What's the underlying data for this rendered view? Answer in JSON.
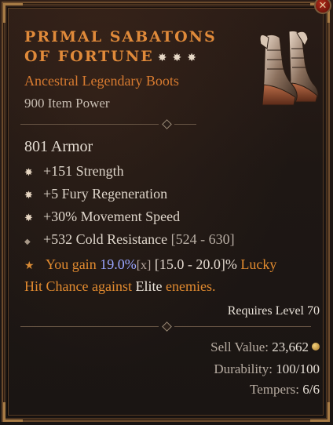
{
  "item": {
    "name": "PRIMAL SABATONS OF FORTUNE",
    "stars": [
      "✸",
      "✸",
      "✸"
    ],
    "type": "Ancestral Legendary Boots",
    "item_power": "900 Item Power",
    "armor": "801 Armor",
    "icon": "boots-icon"
  },
  "affixes": [
    {
      "bullet": "✸",
      "text": "+151 Strength",
      "range": ""
    },
    {
      "bullet": "✸",
      "text": "+5 Fury Regeneration",
      "range": ""
    },
    {
      "bullet": "✸",
      "text": "+30% Movement Speed",
      "range": ""
    },
    {
      "bullet": "◆",
      "text": "+532 Cold Resistance",
      "range": "[524 - 630]"
    }
  ],
  "aspect": {
    "bullet": "★",
    "prefix": "You gain",
    "value": "19.0%",
    "marker": "[x]",
    "range": "[15.0 - 20.0]%",
    "suffix1": "Lucky",
    "suffix2": "Hit Chance against",
    "elite": "Elite",
    "end": "enemies."
  },
  "requires_level": "Requires Level 70",
  "footer": {
    "sell_label": "Sell Value:",
    "sell_value": "23,662",
    "durability_label": "Durability:",
    "durability_value": "100/100",
    "tempers_label": "Tempers:",
    "tempers_value": "6/6"
  },
  "close_label": "✕",
  "colors": {
    "legendary": "#e08a3a",
    "value_blue": "#9aa6ff"
  }
}
